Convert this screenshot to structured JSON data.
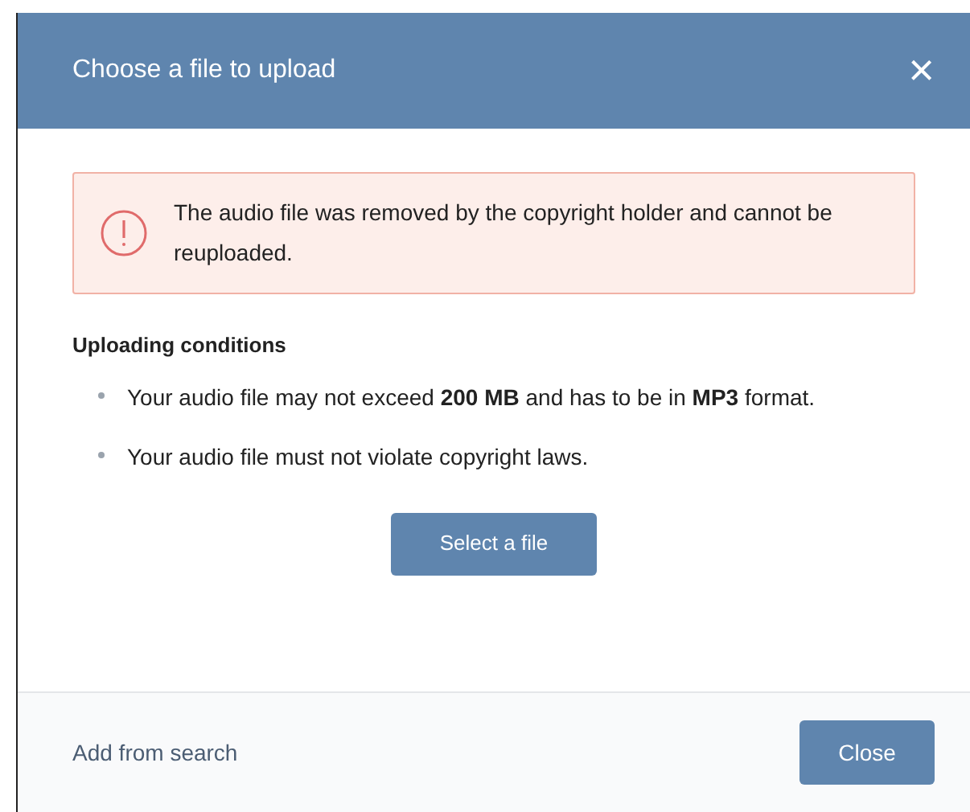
{
  "dialog": {
    "title": "Choose a file to upload",
    "close_icon": "×"
  },
  "alert": {
    "message": "The audio file was removed by the copyright holder and cannot be reuploaded."
  },
  "conditions": {
    "title": "Uploading conditions",
    "items": [
      "Your audio file may not exceed **200 MB** and has to be in **MP3** format.",
      "Your audio file must not violate copyright laws."
    ]
  },
  "select_button": "Select a file",
  "footer": {
    "link": "Add from search",
    "button": "Close"
  }
}
